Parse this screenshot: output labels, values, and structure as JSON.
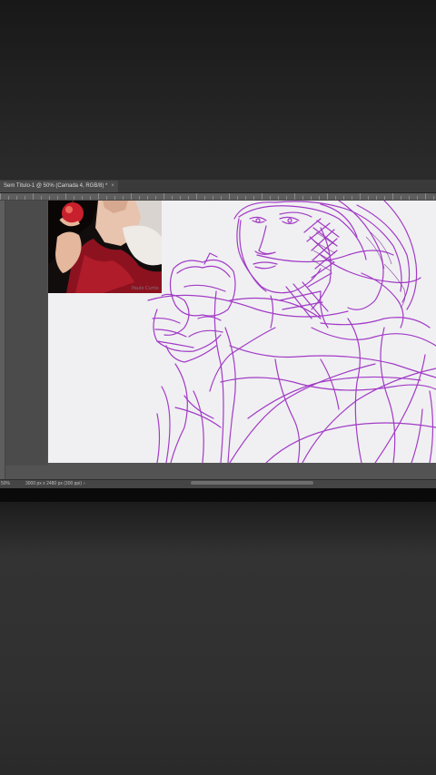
{
  "document": {
    "tab_title": "Sem Título-1 @ 50% (Camada 4, RGB/8) *",
    "close_symbol": "×"
  },
  "status": {
    "zoom": "50%",
    "doc_info": "3000 px x 2480 px (300 ppi)",
    "arrow": "›"
  },
  "reference_photo": {
    "signature": "Paulo Curtis"
  },
  "colors": {
    "sketch_stroke": "#a23bc6",
    "canvas": "#f0f0f2",
    "workspace": "#535353",
    "photo_red": "#8d1220"
  },
  "icons": {
    "tab_close": "close-icon"
  }
}
